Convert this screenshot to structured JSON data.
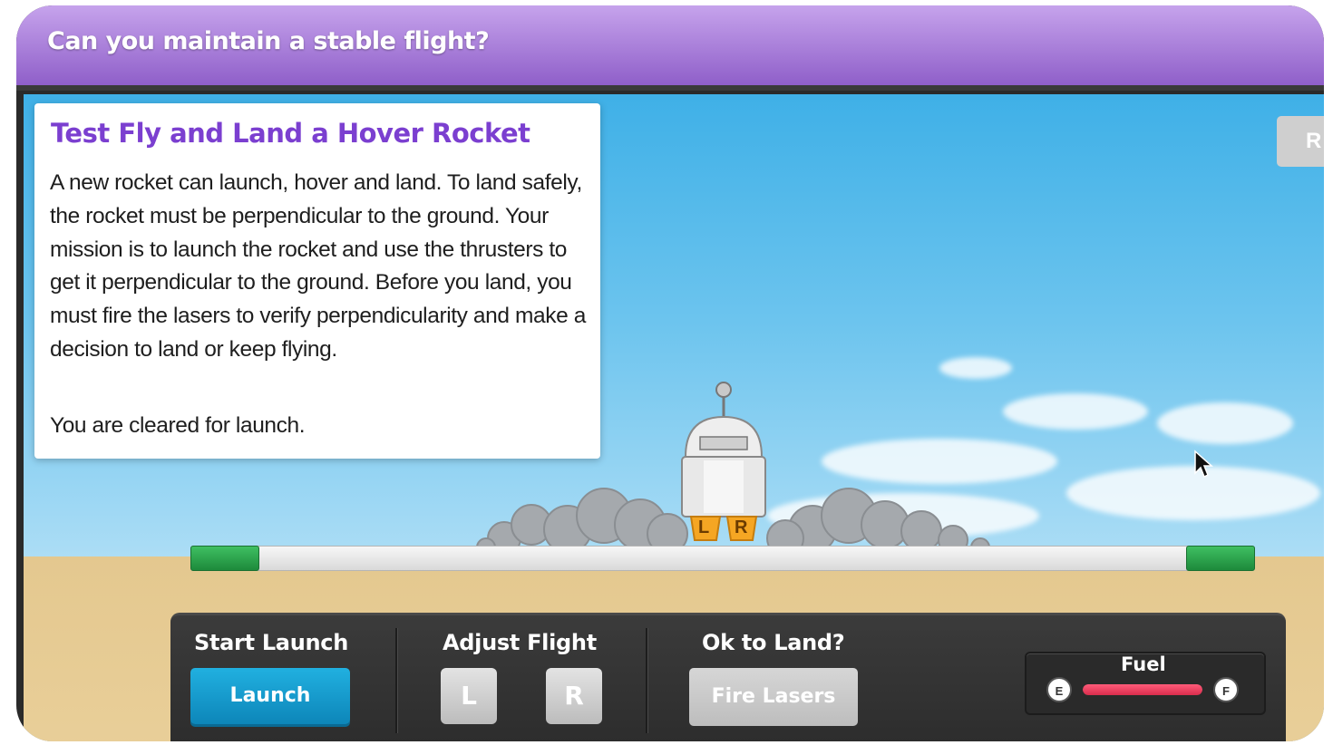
{
  "header": {
    "title": "Can you maintain a stable flight?"
  },
  "mission": {
    "title": "Test Fly and Land a Hover Rocket",
    "body": "A new rocket can launch, hover and land. To land safely, the rocket must be perpendicular to the ground. Your mission is to launch the rocket and use the thrusters to get it perpendicular to the ground. Before you land, you must fire the lasers to verify perpendicularity and make a decision to land or keep flying.",
    "cleared": "You are cleared for launch."
  },
  "reset_button": {
    "label": "R"
  },
  "rocket": {
    "left_thruster": "L",
    "right_thruster": "R"
  },
  "controls": {
    "start_launch": {
      "heading": "Start Launch",
      "button": "Launch"
    },
    "adjust_flight": {
      "heading": "Adjust Flight",
      "left_button": "L",
      "right_button": "R"
    },
    "ok_to_land": {
      "heading": "Ok to Land?",
      "button": "Fire Lasers"
    },
    "fuel": {
      "label": "Fuel",
      "empty_mark": "E",
      "full_mark": "F",
      "level": 1.0
    }
  },
  "colors": {
    "title_bar": "#a877dc",
    "mission_title": "#7b3fd0",
    "launch_button": "#1799cc",
    "landing_pad": "#2aa04c",
    "fuel_bar": "#e93a5a",
    "thruster": "#f5a623"
  }
}
